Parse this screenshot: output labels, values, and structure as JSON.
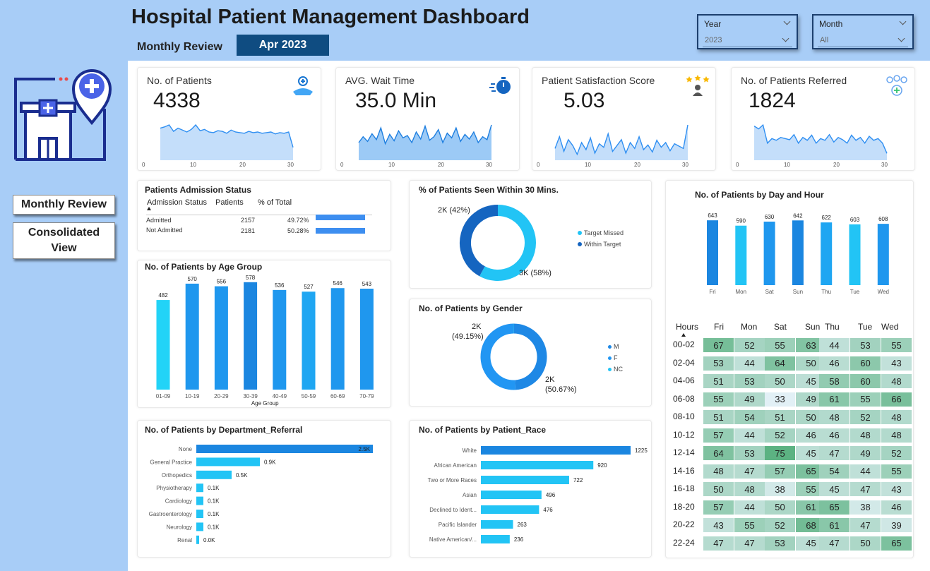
{
  "header": {
    "title": "Hospital Patient Management Dashboard",
    "subtitle": "Monthly  Review",
    "period": "Apr 2023"
  },
  "filters": {
    "year_label": "Year",
    "year_value": "2023",
    "month_label": "Month",
    "month_value": "All"
  },
  "nav": {
    "monthly": "Monthly  Review",
    "consolidated": "Consolidated View"
  },
  "kpis": [
    {
      "label": "No. of Patients",
      "value": "4338",
      "spark": [
        50,
        52,
        55,
        45,
        50,
        47,
        44,
        48,
        55,
        46,
        48,
        44,
        43,
        46,
        45,
        42,
        47,
        44,
        43,
        42,
        45,
        43,
        44,
        42,
        43,
        44,
        41,
        43,
        42,
        44,
        20
      ]
    },
    {
      "label": "AVG. Wait Time",
      "value": "35.0 Min",
      "spark": [
        30,
        40,
        32,
        45,
        35,
        55,
        28,
        44,
        33,
        50,
        38,
        42,
        30,
        48,
        36,
        58,
        34,
        40,
        52,
        30,
        46,
        38,
        55,
        32,
        44,
        36,
        48,
        30,
        40,
        35,
        60
      ]
    },
    {
      "label": "Patient Satisfaction Score",
      "value": "5.03",
      "spark": [
        20,
        40,
        15,
        35,
        25,
        10,
        30,
        18,
        38,
        12,
        28,
        22,
        45,
        15,
        25,
        35,
        12,
        30,
        20,
        40,
        18,
        26,
        14,
        34,
        22,
        30,
        16,
        28,
        24,
        20,
        60
      ]
    },
    {
      "label": "No. of Patients Referred",
      "value": "1824",
      "spark": [
        60,
        55,
        62,
        30,
        38,
        35,
        40,
        38,
        36,
        45,
        30,
        40,
        35,
        44,
        30,
        38,
        35,
        45,
        32,
        40,
        36,
        30,
        44,
        35,
        40,
        30,
        42,
        35,
        38,
        30,
        12
      ]
    }
  ],
  "spark_ticks": [
    "0",
    "10",
    "20",
    "30"
  ],
  "admission": {
    "title": "Patients Admission Status",
    "headers": [
      "Admission Status",
      "Patients",
      "% of Total"
    ],
    "rows": [
      {
        "status": "Admitted",
        "patients": "2157",
        "pct": "49.72%",
        "frac": 0.4972
      },
      {
        "status": "Not Admitted",
        "patients": "2181",
        "pct": "50.28%",
        "frac": 0.5028
      }
    ]
  },
  "seen30": {
    "title": "% of Patients Seen Within 30 Mins.",
    "legend": [
      "Target Missed",
      "Within Target"
    ],
    "label_within": "2K (42%)",
    "label_missed": "3K (58%)",
    "within": 42,
    "missed": 58,
    "colors": [
      "#22c4f5",
      "#1565c0"
    ]
  },
  "gender": {
    "title": "No. of Patients by Gender",
    "legend": [
      "M",
      "F",
      "NC"
    ],
    "label_a": "2K",
    "label_a2": "(49.15%)",
    "label_b": "2K",
    "label_b2": "(50.67%)",
    "values": [
      49.15,
      50.67,
      0.18
    ],
    "colors": [
      "#1e88e5",
      "#2196f3",
      "#22c4f5"
    ]
  },
  "dayhour": {
    "title": "No. of Patients by Day and Hour"
  },
  "age": {
    "title": "No. of Patients by Age Group"
  },
  "dept": {
    "title": "No. of Patients by Department_Referral"
  },
  "race": {
    "title": "No. of Patients by Patient_Race"
  },
  "chart_data": [
    {
      "type": "bar",
      "title": "No. of Patients by Age Group",
      "categories": [
        "01-09",
        "10-19",
        "20-29",
        "30-39",
        "40-49",
        "50-59",
        "60-69",
        "70-79"
      ],
      "values": [
        482,
        570,
        556,
        578,
        536,
        527,
        546,
        543
      ],
      "labels": [
        "482",
        "570",
        "556",
        "578",
        "536",
        "527",
        "546",
        "543"
      ],
      "xlabel": "Age Group",
      "ylim": [
        0,
        600
      ]
    },
    {
      "type": "bar",
      "title": "No. of Patients by Day and Hour",
      "categories": [
        "Fri",
        "Mon",
        "Sat",
        "Sun",
        "Thu",
        "Tue",
        "Wed"
      ],
      "values": [
        643,
        590,
        630,
        642,
        622,
        603,
        608
      ],
      "labels": [
        "643",
        "590",
        "630",
        "642",
        "622",
        "603",
        "608"
      ],
      "ylim": [
        0,
        700
      ]
    },
    {
      "type": "bar",
      "orientation": "horizontal",
      "title": "No. of Patients by Department_Referral",
      "categories": [
        "None",
        "General Practice",
        "Orthopedics",
        "Physiotherapy",
        "Cardiology",
        "Gastroenterology",
        "Neurology",
        "Renal"
      ],
      "values": [
        2500,
        900,
        500,
        100,
        100,
        100,
        100,
        0
      ],
      "labels": [
        "2.5K",
        "0.9K",
        "0.5K",
        "0.1K",
        "0.1K",
        "0.1K",
        "0.1K",
        "0.0K"
      ]
    },
    {
      "type": "bar",
      "orientation": "horizontal",
      "title": "No. of Patients by Patient_Race",
      "categories": [
        "White",
        "African American",
        "Two or More Races",
        "Asian",
        "Declined to Ident...",
        "Pacific Islander",
        "Native American/..."
      ],
      "values": [
        1225,
        920,
        722,
        496,
        476,
        263,
        236
      ],
      "labels": [
        "1225",
        "920",
        "722",
        "496",
        "476",
        "263",
        "236"
      ]
    },
    {
      "type": "heatmap",
      "title": "No. of Patients by Day and Hour",
      "corner": "Hours",
      "columns": [
        "Fri",
        "Mon",
        "Sat",
        "Sun",
        "Thu",
        "Tue",
        "Wed"
      ],
      "rows": [
        "00-02",
        "02-04",
        "04-06",
        "06-08",
        "08-10",
        "10-12",
        "12-14",
        "14-16",
        "16-18",
        "18-20",
        "20-22",
        "22-24"
      ],
      "values": [
        [
          67,
          52,
          55,
          63,
          44,
          53,
          55
        ],
        [
          53,
          44,
          64,
          50,
          46,
          60,
          43
        ],
        [
          51,
          53,
          50,
          45,
          58,
          60,
          48
        ],
        [
          55,
          49,
          33,
          49,
          61,
          55,
          66
        ],
        [
          51,
          54,
          51,
          50,
          48,
          52,
          48
        ],
        [
          57,
          44,
          52,
          46,
          46,
          48,
          48
        ],
        [
          64,
          53,
          75,
          45,
          47,
          49,
          52
        ],
        [
          48,
          47,
          57,
          65,
          54,
          44,
          55
        ],
        [
          50,
          48,
          38,
          55,
          45,
          47,
          43
        ],
        [
          57,
          44,
          50,
          61,
          65,
          38,
          46
        ],
        [
          43,
          55,
          52,
          68,
          61,
          47,
          39
        ],
        [
          47,
          47,
          53,
          45,
          47,
          50,
          65
        ]
      ]
    }
  ]
}
